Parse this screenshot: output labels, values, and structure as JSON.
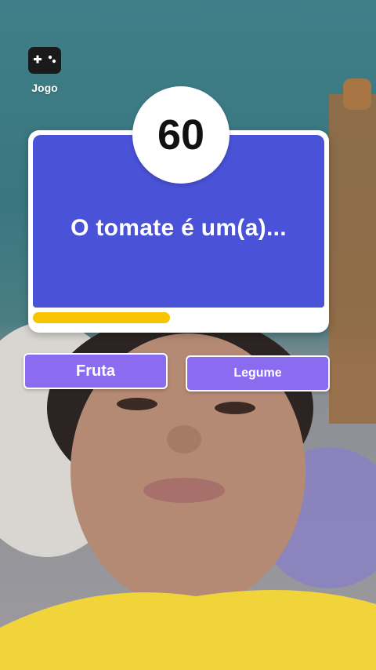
{
  "app": {
    "badge_label": "Jogo",
    "badge_icon": "gamepad-icon"
  },
  "quiz": {
    "timer_value": "60",
    "question": "O tomate é um(a)...",
    "progress_fraction": 0.47,
    "answers": [
      {
        "label": "Fruta"
      },
      {
        "label": "Legume"
      }
    ]
  },
  "colors": {
    "card_blue": "#4a52d8",
    "answer_purple": "#8b6bf0",
    "progress_yellow": "#f7c400"
  }
}
